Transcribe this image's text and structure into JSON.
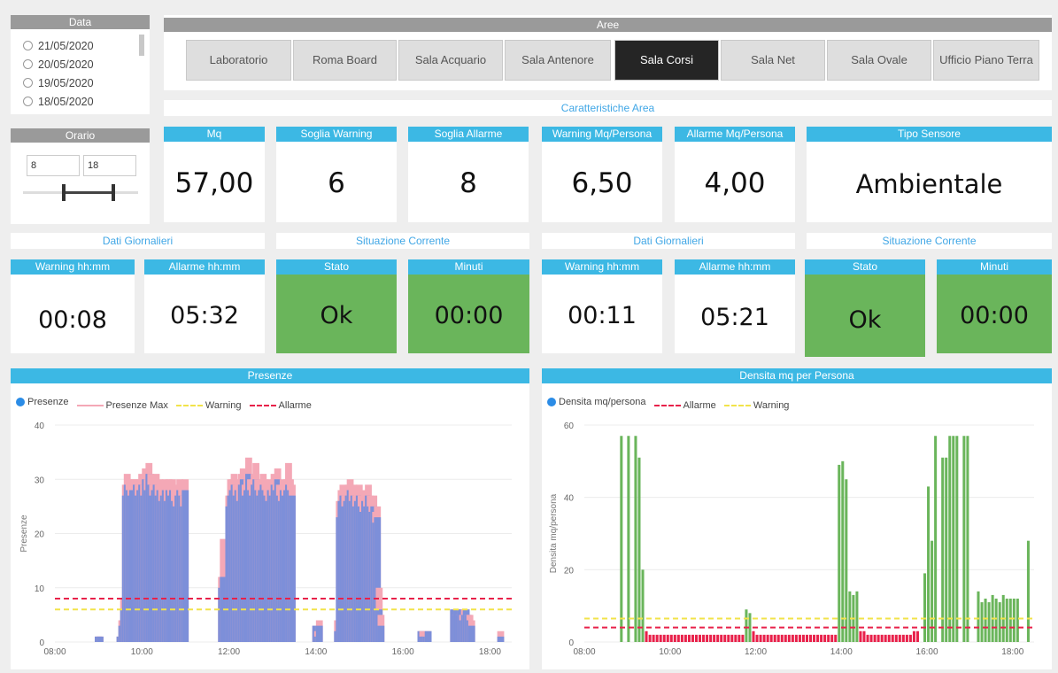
{
  "data_panel": {
    "title": "Data",
    "dates": [
      "21/05/2020",
      "20/05/2020",
      "19/05/2020",
      "18/05/2020"
    ]
  },
  "orario": {
    "title": "Orario",
    "from": "8",
    "to": "18"
  },
  "aree": {
    "title": "Aree",
    "tabs": [
      "Laboratorio",
      "Roma Board",
      "Sala Acquario",
      "Sala Antenore",
      "Sala Corsi",
      "Sala Net",
      "Sala Ovale",
      "Ufficio Piano Terra"
    ],
    "active": "Sala Corsi"
  },
  "caratteristiche": {
    "title": "Caratteristiche Area"
  },
  "kpis": [
    {
      "label": "Mq",
      "value": "57,00"
    },
    {
      "label": "Soglia Warning",
      "value": "6"
    },
    {
      "label": "Soglia Allarme",
      "value": "8"
    },
    {
      "label": "Warning Mq/Persona",
      "value": "6,50"
    },
    {
      "label": "Allarme Mq/Persona",
      "value": "4,00"
    },
    {
      "label": "Tipo Sensore",
      "value": "Ambientale"
    }
  ],
  "left_block": {
    "dati": "Dati Giornalieri",
    "situazione": "Situazione Corrente",
    "warning_label": "Warning hh:mm",
    "warning": "00:08",
    "allarme_label": "Allarme hh:mm",
    "allarme": "05:32",
    "stato_label": "Stato",
    "stato": "Ok",
    "minuti_label": "Minuti",
    "minuti": "00:00"
  },
  "right_block": {
    "dati": "Dati Giornalieri",
    "situazione": "Situazione Corrente",
    "warning_label": "Warning hh:mm",
    "warning": "00:11",
    "allarme_label": "Allarme hh:mm",
    "allarme": "05:21",
    "stato_label": "Stato",
    "stato": "Ok",
    "minuti_label": "Minuti",
    "minuti": "00:00"
  },
  "colors": {
    "accent": "#3cb8e4",
    "ok_green": "#6ab55b",
    "bar_blue": "#7d8fd9",
    "max_pink": "#f4a8b6",
    "warning": "#f2e34a",
    "allarme": "#e8214a",
    "density_green": "#6ab55b",
    "density_red": "#e8214a"
  },
  "chart_data": [
    {
      "type": "bar",
      "title": "Presenze",
      "ylabel": "Presenze",
      "ylim": [
        0,
        40
      ],
      "yticks": [
        0,
        10,
        20,
        30,
        40
      ],
      "xlim": [
        "08:00",
        "18:30"
      ],
      "xticks": [
        "08:00",
        "10:00",
        "12:00",
        "14:00",
        "16:00",
        "18:00"
      ],
      "legend": [
        "Presenze",
        "Presenze Max",
        "Warning",
        "Allarme"
      ],
      "warning": 6,
      "allarme": 8,
      "segments": [
        {
          "start": "08:55",
          "values": [
            1,
            1
          ],
          "max": [
            1,
            1
          ]
        },
        {
          "start": "09:25",
          "values": [
            1,
            3,
            6,
            27,
            29,
            28,
            27,
            28,
            28,
            29,
            27,
            28,
            29,
            27,
            30,
            28,
            31,
            29,
            27,
            28,
            29,
            27,
            28,
            26,
            27,
            28,
            26,
            28,
            27,
            28,
            26,
            25,
            27,
            28,
            27,
            25,
            28
          ],
          "max": [
            1,
            4,
            8,
            29,
            31,
            30,
            29,
            30,
            30,
            30,
            29,
            30,
            31,
            29,
            32,
            30,
            33,
            31,
            29,
            30,
            31,
            29,
            30,
            28,
            29,
            30,
            28,
            30,
            29,
            30,
            28,
            27,
            29,
            30,
            29,
            27,
            30
          ]
        },
        {
          "start": "11:45",
          "values": [
            10,
            12
          ],
          "max": [
            12,
            19
          ]
        },
        {
          "start": "11:55",
          "values": [
            25,
            27,
            28,
            29,
            27,
            28,
            26,
            29,
            30,
            27,
            28,
            31,
            28,
            27,
            29,
            30,
            28,
            27,
            28,
            29,
            28,
            27,
            26,
            28,
            27,
            29,
            28,
            30,
            27,
            26,
            28,
            27,
            28,
            29,
            28,
            27
          ],
          "max": [
            27,
            30,
            30,
            31,
            29,
            30,
            28,
            31,
            32,
            29,
            30,
            34,
            30,
            29,
            31,
            33,
            30,
            29,
            30,
            31,
            30,
            29,
            28,
            30,
            29,
            31,
            30,
            32,
            29,
            28,
            30,
            29,
            30,
            33,
            30,
            29
          ]
        },
        {
          "start": "13:55",
          "values": [
            3,
            1,
            3
          ],
          "max": [
            3,
            2,
            4
          ]
        },
        {
          "start": "14:25",
          "values": [
            2,
            23,
            26,
            27,
            25,
            26,
            27,
            28,
            26,
            27,
            25,
            26,
            27,
            25,
            24,
            26,
            25,
            27,
            25,
            24,
            25,
            22,
            23,
            6,
            3
          ],
          "max": [
            4,
            26,
            28,
            29,
            27,
            28,
            29,
            30,
            28,
            29,
            27,
            28,
            29,
            27,
            26,
            28,
            27,
            29,
            27,
            26,
            27,
            24,
            25,
            10,
            5
          ]
        },
        {
          "start": "16:20",
          "values": [
            2,
            1,
            1,
            1,
            2
          ],
          "max": [
            2,
            2,
            1,
            2,
            2
          ]
        },
        {
          "start": "17:05",
          "values": [
            6,
            5,
            6,
            5,
            6,
            4,
            5,
            6,
            5,
            4,
            3
          ],
          "max": [
            6,
            5,
            6,
            5,
            6,
            5,
            6,
            6,
            5,
            5,
            4
          ]
        },
        {
          "start": "18:10",
          "values": [
            1
          ],
          "max": [
            2
          ]
        }
      ]
    },
    {
      "type": "bar",
      "title": "Densita mq per Persona",
      "ylabel": "Densita mq/persona",
      "ylim": [
        0,
        60
      ],
      "yticks": [
        0,
        20,
        40,
        60
      ],
      "xlim": [
        "08:00",
        "18:30"
      ],
      "xticks": [
        "08:00",
        "10:00",
        "12:00",
        "14:00",
        "16:00",
        "18:00"
      ],
      "legend": [
        "Densita mq/persona",
        "Allarme",
        "Warning"
      ],
      "warning": 6.5,
      "allarme": 4,
      "bars": [
        [
          "08:50",
          57
        ],
        [
          "09:00",
          57
        ],
        [
          "09:10",
          57
        ],
        [
          "09:15",
          51
        ],
        [
          "09:20",
          20
        ],
        [
          "09:25",
          3
        ],
        [
          "09:30",
          2
        ],
        [
          "09:35",
          2
        ],
        [
          "09:40",
          2
        ],
        [
          "09:45",
          2
        ],
        [
          "09:50",
          2
        ],
        [
          "09:55",
          2
        ],
        [
          "10:00",
          2
        ],
        [
          "10:05",
          2
        ],
        [
          "10:10",
          2
        ],
        [
          "10:15",
          2
        ],
        [
          "10:20",
          2
        ],
        [
          "10:25",
          2
        ],
        [
          "10:30",
          2
        ],
        [
          "10:35",
          2
        ],
        [
          "10:40",
          2
        ],
        [
          "10:45",
          2
        ],
        [
          "10:50",
          2
        ],
        [
          "10:55",
          2
        ],
        [
          "11:00",
          2
        ],
        [
          "11:05",
          2
        ],
        [
          "11:10",
          2
        ],
        [
          "11:15",
          2
        ],
        [
          "11:20",
          2
        ],
        [
          "11:25",
          2
        ],
        [
          "11:30",
          2
        ],
        [
          "11:35",
          2
        ],
        [
          "11:40",
          2
        ],
        [
          "11:45",
          9
        ],
        [
          "11:50",
          8
        ],
        [
          "11:55",
          3
        ],
        [
          "12:00",
          2
        ],
        [
          "12:05",
          2
        ],
        [
          "12:10",
          2
        ],
        [
          "12:15",
          2
        ],
        [
          "12:20",
          2
        ],
        [
          "12:25",
          2
        ],
        [
          "12:30",
          2
        ],
        [
          "12:35",
          2
        ],
        [
          "12:40",
          2
        ],
        [
          "12:45",
          2
        ],
        [
          "12:50",
          2
        ],
        [
          "12:55",
          2
        ],
        [
          "13:00",
          2
        ],
        [
          "13:05",
          2
        ],
        [
          "13:10",
          2
        ],
        [
          "13:15",
          2
        ],
        [
          "13:20",
          2
        ],
        [
          "13:25",
          2
        ],
        [
          "13:30",
          2
        ],
        [
          "13:35",
          2
        ],
        [
          "13:40",
          2
        ],
        [
          "13:45",
          2
        ],
        [
          "13:50",
          2
        ],
        [
          "13:55",
          49
        ],
        [
          "14:00",
          50
        ],
        [
          "14:05",
          45
        ],
        [
          "14:10",
          14
        ],
        [
          "14:15",
          13
        ],
        [
          "14:20",
          14
        ],
        [
          "14:25",
          3
        ],
        [
          "14:30",
          3
        ],
        [
          "14:35",
          2
        ],
        [
          "14:40",
          2
        ],
        [
          "14:45",
          2
        ],
        [
          "14:50",
          2
        ],
        [
          "14:55",
          2
        ],
        [
          "15:00",
          2
        ],
        [
          "15:05",
          2
        ],
        [
          "15:10",
          2
        ],
        [
          "15:15",
          2
        ],
        [
          "15:20",
          2
        ],
        [
          "15:25",
          2
        ],
        [
          "15:30",
          2
        ],
        [
          "15:35",
          2
        ],
        [
          "15:40",
          3
        ],
        [
          "15:45",
          3
        ],
        [
          "15:55",
          19
        ],
        [
          "16:00",
          43
        ],
        [
          "16:05",
          28
        ],
        [
          "16:10",
          57
        ],
        [
          "16:20",
          51
        ],
        [
          "16:25",
          51
        ],
        [
          "16:30",
          57
        ],
        [
          "16:35",
          57
        ],
        [
          "16:40",
          57
        ],
        [
          "16:50",
          57
        ],
        [
          "16:55",
          57
        ],
        [
          "17:10",
          14
        ],
        [
          "17:15",
          11
        ],
        [
          "17:20",
          12
        ],
        [
          "17:25",
          11
        ],
        [
          "17:30",
          13
        ],
        [
          "17:35",
          12
        ],
        [
          "17:40",
          11
        ],
        [
          "17:45",
          13
        ],
        [
          "17:50",
          12
        ],
        [
          "17:55",
          12
        ],
        [
          "18:00",
          12
        ],
        [
          "18:05",
          12
        ],
        [
          "18:20",
          28
        ]
      ]
    }
  ]
}
